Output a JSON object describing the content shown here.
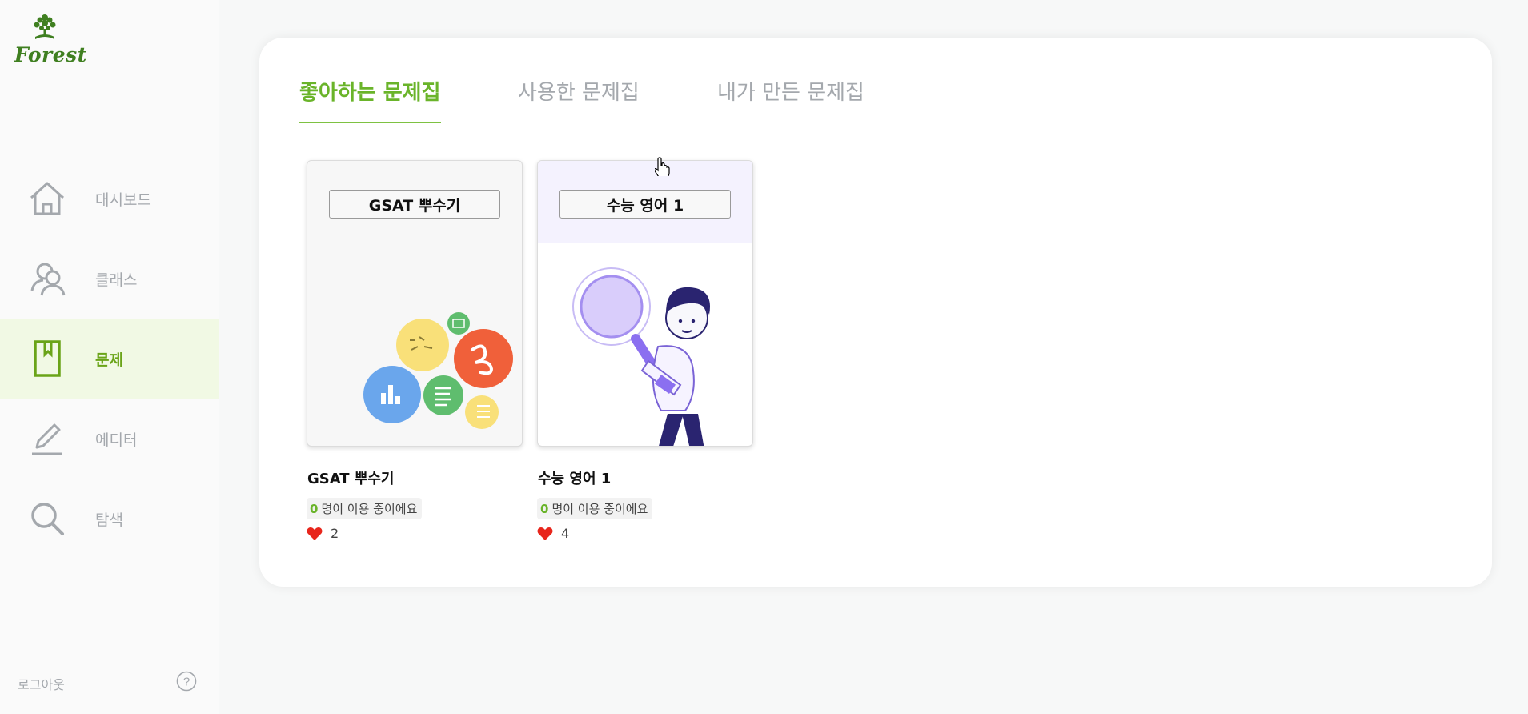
{
  "brand": {
    "name": "Forest"
  },
  "sidebar": {
    "items": [
      {
        "label": "대시보드",
        "icon": "home-icon",
        "active": false
      },
      {
        "label": "클래스",
        "icon": "users-icon",
        "active": false
      },
      {
        "label": "문제",
        "icon": "bookmark-icon",
        "active": true
      },
      {
        "label": "에디터",
        "icon": "pen-icon",
        "active": false
      },
      {
        "label": "탐색",
        "icon": "search-icon",
        "active": false
      }
    ],
    "logout": "로그아웃",
    "help_icon": "help-circle-icon"
  },
  "tabs": [
    {
      "label": "좋아하는 문제집",
      "active": true
    },
    {
      "label": "사용한 문제집",
      "active": false
    },
    {
      "label": "내가 만든 문제집",
      "active": false
    }
  ],
  "cards": [
    {
      "thumb_title": "GSAT 뿌수기",
      "name": "GSAT 뿌수기",
      "users": "0",
      "users_suffix": "명이 이용 중이에요",
      "likes": "2"
    },
    {
      "thumb_title": "수능 영어 1",
      "name": "수능 영어 1",
      "users": "0",
      "users_suffix": "명이 이용 중이에요",
      "likes": "4"
    }
  ],
  "colors": {
    "accent": "#6ab42a",
    "active_bg": "#f1f9e4",
    "muted": "#a4a8ad",
    "heart": "#e8261c"
  }
}
